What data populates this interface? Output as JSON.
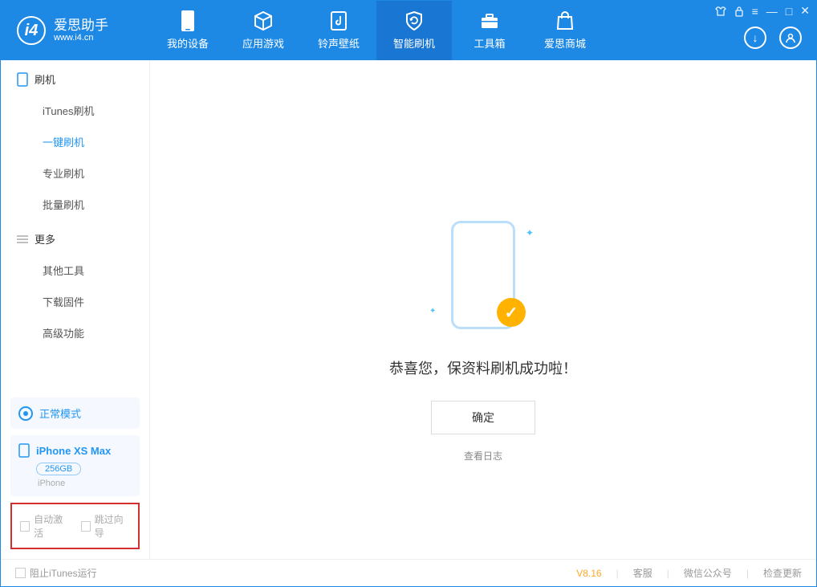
{
  "brand": {
    "cn": "爱思助手",
    "en": "www.i4.cn"
  },
  "tabs": {
    "device": "我的设备",
    "apps": "应用游戏",
    "ringtone": "铃声壁纸",
    "flash": "智能刷机",
    "toolbox": "工具箱",
    "store": "爱思商城"
  },
  "sidebar": {
    "section1": "刷机",
    "items1": [
      "iTunes刷机",
      "一键刷机",
      "专业刷机",
      "批量刷机"
    ],
    "section2": "更多",
    "items2": [
      "其他工具",
      "下载固件",
      "高级功能"
    ]
  },
  "device": {
    "mode": "正常模式",
    "name": "iPhone XS Max",
    "storage": "256GB",
    "type": "iPhone"
  },
  "options": {
    "auto_activate": "自动激活",
    "skip_guide": "跳过向导"
  },
  "main": {
    "success": "恭喜您，保资料刷机成功啦！",
    "confirm": "确定",
    "view_log": "查看日志"
  },
  "footer": {
    "block_itunes": "阻止iTunes运行",
    "version": "V8.16",
    "support": "客服",
    "wechat": "微信公众号",
    "update": "检查更新"
  }
}
